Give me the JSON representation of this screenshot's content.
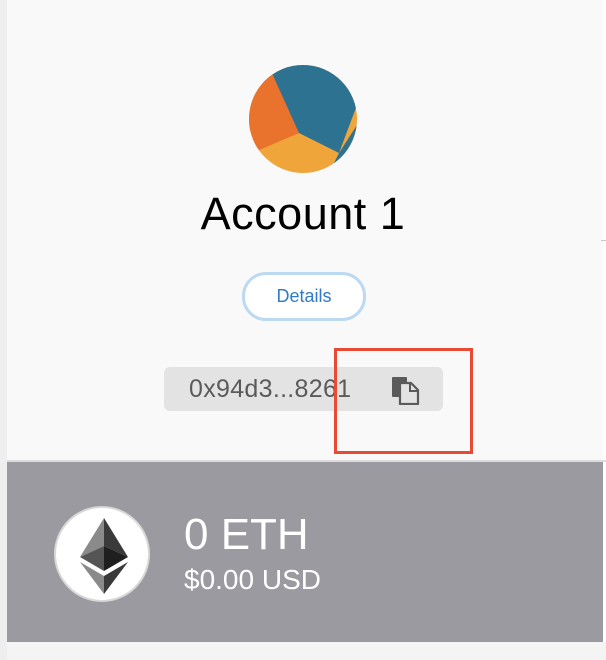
{
  "account": {
    "name": "Account 1",
    "details_label": "Details",
    "address_short": "0x94d3...8261"
  },
  "balance": {
    "eth": "0 ETH",
    "usd": "$0.00 USD"
  },
  "icons": {
    "avatar": "identicon-avatar",
    "copy": "copy-icon",
    "token": "ethereum-logo-icon"
  },
  "colors": {
    "accent_blue": "#2f7bc5",
    "details_border": "#bcd9f2",
    "highlight_red": "#e84a33",
    "balance_bg": "#9a9aa0",
    "avatar_teal": "#2d7290",
    "avatar_orange": "#e9722d",
    "avatar_yellow": "#f0a53a"
  }
}
